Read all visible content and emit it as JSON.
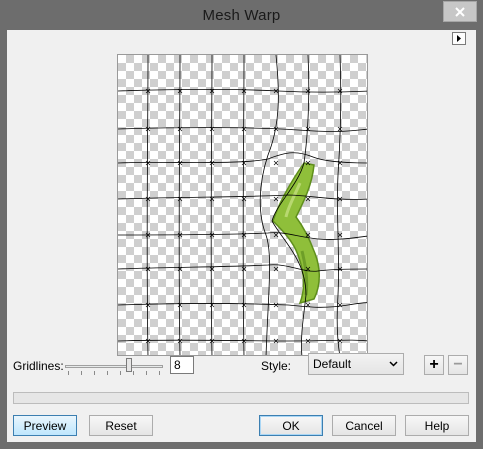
{
  "window": {
    "title": "Mesh Warp",
    "close_icon": "close-icon"
  },
  "options": {
    "expand_icon": "triangle-right-icon"
  },
  "gridlines": {
    "label": "Gridlines:",
    "value": "8",
    "slider_fraction": 0.66
  },
  "style": {
    "label": "Style:",
    "selected": "Default"
  },
  "zoom": {
    "plus": "+",
    "minus": "−"
  },
  "buttons": {
    "preview": "Preview",
    "reset": "Reset",
    "ok": "OK",
    "cancel": "Cancel",
    "help": "Help"
  },
  "colors": {
    "focus_border": "#3c7fb1",
    "object_green": "#8fbf3a"
  }
}
